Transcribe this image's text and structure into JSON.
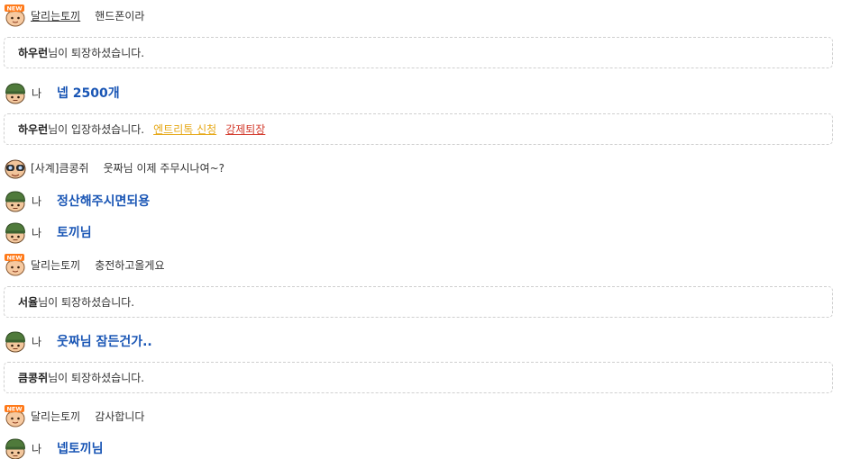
{
  "colors": {
    "my_message": "#1a56b5",
    "entry_request": "#e6a817",
    "force_exit": "#d33a2c",
    "system_border": "#cfcfcf"
  },
  "icons": {
    "newbie_avatar": "rabbit-new-avatar-icon",
    "me_avatar": "soldier-helmet-avatar-icon",
    "staff_avatar": "goggles-avatar-icon"
  },
  "messages": [
    {
      "type": "other",
      "avatar": "newbie",
      "nick": "달리는토끼",
      "text": "핸드폰이라"
    },
    {
      "type": "system",
      "nick": "하우런",
      "text": "님이 퇴장하셨습니다."
    },
    {
      "type": "me",
      "label": "나",
      "text": "넵 2500개"
    },
    {
      "type": "system",
      "nick": "하우런",
      "text": "님이 입장하셨습니다.",
      "action1": "엔트리톡 신청",
      "action2": "강제퇴장"
    },
    {
      "type": "other",
      "avatar": "staff",
      "nick": "[사계]큼콩쥐",
      "text": "웃짜님 이제 주무시나여~?"
    },
    {
      "type": "me",
      "label": "나",
      "text": "정산해주시면되용"
    },
    {
      "type": "me",
      "label": "나",
      "text": "토끼님"
    },
    {
      "type": "other",
      "avatar": "newbie",
      "nick": "달리는토끼",
      "text": "충전하고올게요"
    },
    {
      "type": "system",
      "nick": "서율",
      "text": "님이 퇴장하셨습니다."
    },
    {
      "type": "me",
      "label": "나",
      "text": "웃짜님 잠든건가.."
    },
    {
      "type": "system",
      "nick": "큼콩쥐",
      "text": "님이 퇴장하셨습니다."
    },
    {
      "type": "other",
      "avatar": "newbie",
      "nick": "달리는토끼",
      "text": "감사합니다"
    },
    {
      "type": "me",
      "label": "나",
      "text": "넵토끼님"
    }
  ]
}
